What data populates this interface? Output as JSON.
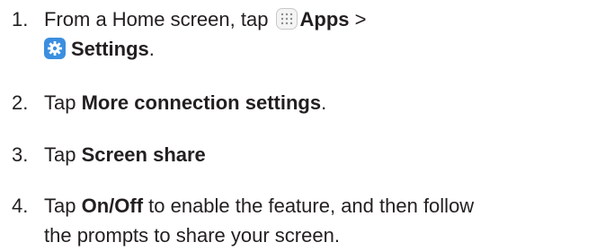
{
  "steps": [
    {
      "number": "1.",
      "line1_text": "From a Home screen, tap ",
      "apps_label": "Apps",
      "line1_after": " >",
      "settings_label": "Settings",
      "line2_after": "."
    },
    {
      "number": "2.",
      "prefix": "Tap ",
      "bold": "More connection settings",
      "suffix": "."
    },
    {
      "number": "3.",
      "prefix": "Tap ",
      "bold": "Screen share",
      "suffix": ""
    },
    {
      "number": "4.",
      "prefix": "Tap ",
      "bold": "On/Off",
      "line1_after": " to enable the feature, and then follow",
      "line2": "the prompts to share your screen."
    }
  ],
  "icons": {
    "apps": "apps-icon",
    "settings": "settings-icon"
  },
  "colors": {
    "text": "#231f20",
    "settings_icon_bg": "#3b8fe0",
    "apps_icon_bg": "#f4f4f4"
  }
}
